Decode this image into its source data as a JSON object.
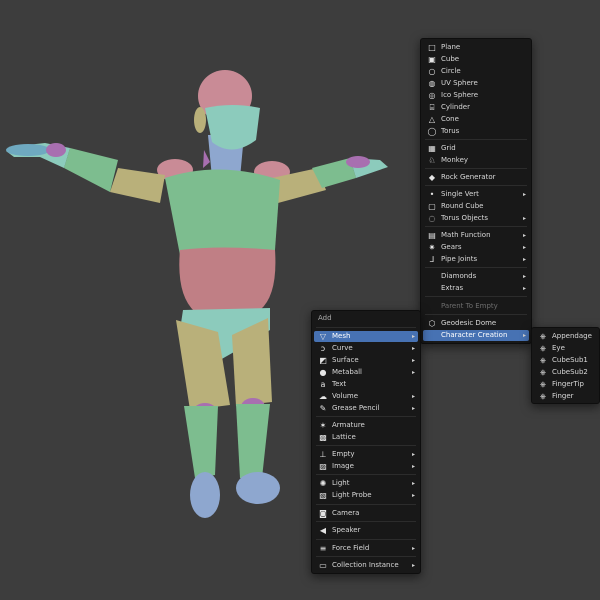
{
  "mesh_menu": {
    "items": [
      {
        "label": "Plane",
        "icon": "plane-icon",
        "submenu": false
      },
      {
        "label": "Cube",
        "icon": "cube-icon",
        "submenu": false
      },
      {
        "label": "Circle",
        "icon": "circle-icon",
        "submenu": false
      },
      {
        "label": "UV Sphere",
        "icon": "uv-sphere-icon",
        "submenu": false
      },
      {
        "label": "Ico Sphere",
        "icon": "ico-sphere-icon",
        "submenu": false
      },
      {
        "label": "Cylinder",
        "icon": "cylinder-icon",
        "submenu": false
      },
      {
        "label": "Cone",
        "icon": "cone-icon",
        "submenu": false
      },
      {
        "label": "Torus",
        "icon": "torus-icon",
        "submenu": false
      },
      {
        "label": "Grid",
        "icon": "grid-icon",
        "submenu": false
      },
      {
        "label": "Monkey",
        "icon": "monkey-icon",
        "submenu": false
      },
      {
        "label": "Rock Generator",
        "icon": "rock-icon",
        "submenu": false
      },
      {
        "label": "Single Vert",
        "icon": "vertex-icon",
        "submenu": true
      },
      {
        "label": "Round Cube",
        "icon": "round-cube-icon",
        "submenu": false
      },
      {
        "label": "Torus Objects",
        "icon": "torus-objects-icon",
        "submenu": true
      },
      {
        "label": "Math Function",
        "icon": "math-function-icon",
        "submenu": true
      },
      {
        "label": "Gears",
        "icon": "gears-icon",
        "submenu": true
      },
      {
        "label": "Pipe Joints",
        "icon": "pipe-joints-icon",
        "submenu": true
      },
      {
        "label": "Diamonds",
        "icon": "",
        "submenu": true
      },
      {
        "label": "Extras",
        "icon": "",
        "submenu": true
      },
      {
        "label": "Parent To Empty",
        "icon": "",
        "submenu": false
      },
      {
        "label": "Geodesic Dome",
        "icon": "geodesic-dome-icon",
        "submenu": false
      },
      {
        "label": "Character Creation",
        "icon": "",
        "submenu": true
      }
    ]
  },
  "add_menu": {
    "title": "Add",
    "items": [
      {
        "label": "Mesh",
        "icon": "mesh-icon",
        "submenu": true
      },
      {
        "label": "Curve",
        "icon": "curve-icon",
        "submenu": true
      },
      {
        "label": "Surface",
        "icon": "surface-icon",
        "submenu": true
      },
      {
        "label": "Metaball",
        "icon": "metaball-icon",
        "submenu": true
      },
      {
        "label": "Text",
        "icon": "text-icon",
        "submenu": false
      },
      {
        "label": "Volume",
        "icon": "volume-icon",
        "submenu": true
      },
      {
        "label": "Grease Pencil",
        "icon": "grease-pencil-icon",
        "submenu": true
      },
      {
        "label": "Armature",
        "icon": "armature-icon",
        "submenu": false
      },
      {
        "label": "Lattice",
        "icon": "lattice-icon",
        "submenu": false
      },
      {
        "label": "Empty",
        "icon": "empty-icon",
        "submenu": true
      },
      {
        "label": "Image",
        "icon": "image-icon",
        "submenu": true
      },
      {
        "label": "Light",
        "icon": "light-icon",
        "submenu": true
      },
      {
        "label": "Light Probe",
        "icon": "light-probe-icon",
        "submenu": true
      },
      {
        "label": "Camera",
        "icon": "camera-icon",
        "submenu": false
      },
      {
        "label": "Speaker",
        "icon": "speaker-icon",
        "submenu": false
      },
      {
        "label": "Force Field",
        "icon": "force-field-icon",
        "submenu": true
      },
      {
        "label": "Collection Instance",
        "icon": "collection-icon",
        "submenu": true
      }
    ]
  },
  "char_menu": {
    "items": [
      {
        "label": "Appendage",
        "icon": "script-icon"
      },
      {
        "label": "Eye",
        "icon": "script-icon"
      },
      {
        "label": "CubeSub1",
        "icon": "script-icon"
      },
      {
        "label": "CubeSub2",
        "icon": "script-icon"
      },
      {
        "label": "FingerTip",
        "icon": "script-icon"
      },
      {
        "label": "Finger",
        "icon": "script-icon"
      }
    ]
  },
  "colors": {
    "background": "#3d3d3d",
    "menu_bg": "#181818",
    "highlight": "#4772b3",
    "skin_green": "#7dbd8f",
    "skin_pink": "#c98b96",
    "skin_teal": "#8ccbbc",
    "skin_tan": "#b9b07a",
    "skin_blue": "#8ea7cf"
  }
}
